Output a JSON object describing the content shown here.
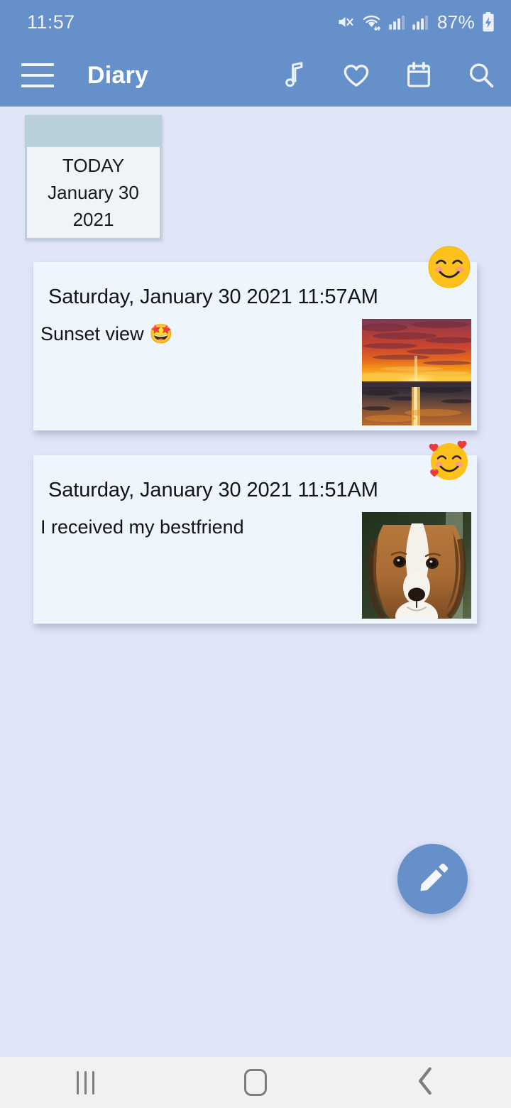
{
  "status_bar": {
    "time": "11:57",
    "battery_percent": "87%",
    "icons": [
      "mute-icon",
      "wifi-icon",
      "signal-icon",
      "signal-icon",
      "battery-charging-icon"
    ]
  },
  "app_bar": {
    "menu_icon": "hamburger-menu-icon",
    "title": "Diary",
    "actions": [
      {
        "icon": "music-note-icon",
        "label": "Music"
      },
      {
        "icon": "heart-icon",
        "label": "Favorites"
      },
      {
        "icon": "calendar-icon",
        "label": "Calendar"
      },
      {
        "icon": "search-icon",
        "label": "Search"
      }
    ]
  },
  "date_card": {
    "label": "TODAY",
    "date": "January 30",
    "year": "2021"
  },
  "entries": [
    {
      "date": "Saturday, January 30 2021 11:57AM",
      "text": "Sunset view 🤩",
      "mood_emoji": "smiling-face-icon",
      "photo": "sunset-beach-photo"
    },
    {
      "date": "Saturday, January 30 2021 11:51AM",
      "text": "I received my bestfriend",
      "mood_emoji": "smiling-face-with-hearts-icon",
      "photo": "dog-portrait-photo"
    }
  ],
  "fab": {
    "icon": "pencil-edit-icon",
    "label": "New entry"
  },
  "nav_bar": {
    "recents_label": "Recents",
    "home_label": "Home",
    "back_label": "Back"
  },
  "colors": {
    "app_bar": "#6690ca",
    "page_background": "#e1e5f8",
    "card_background": "#eff5fd",
    "date_card_frame": "#b9cfd9",
    "fab": "#6690ca",
    "nav_bar": "#f1f1f1"
  }
}
